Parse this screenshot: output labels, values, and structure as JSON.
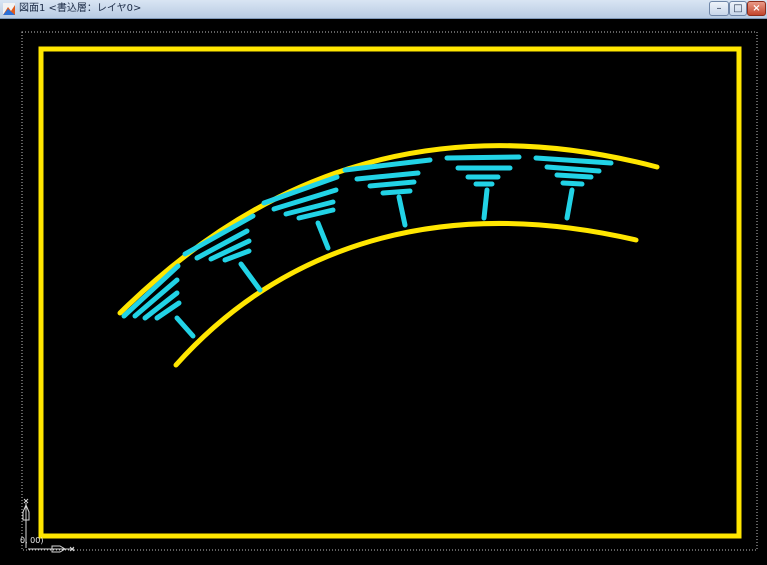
{
  "window": {
    "title": "図面1 <書込層：レイヤ0>",
    "buttons": {
      "minimize": "–",
      "maximize": "□",
      "close": "×"
    }
  },
  "drawing": {
    "coordinate_readout": "0, 00)",
    "colors": {
      "background": "#000000",
      "frame": "#ffe600",
      "curves": "#ffe600",
      "ticks": "#22d3e6",
      "extent": "#bfbfbf"
    },
    "icons": {
      "app": "cad-drawing-icon",
      "ucs_y": "ucs-y-axis-icon",
      "ucs_x": "ucs-x-axis-icon"
    }
  }
}
